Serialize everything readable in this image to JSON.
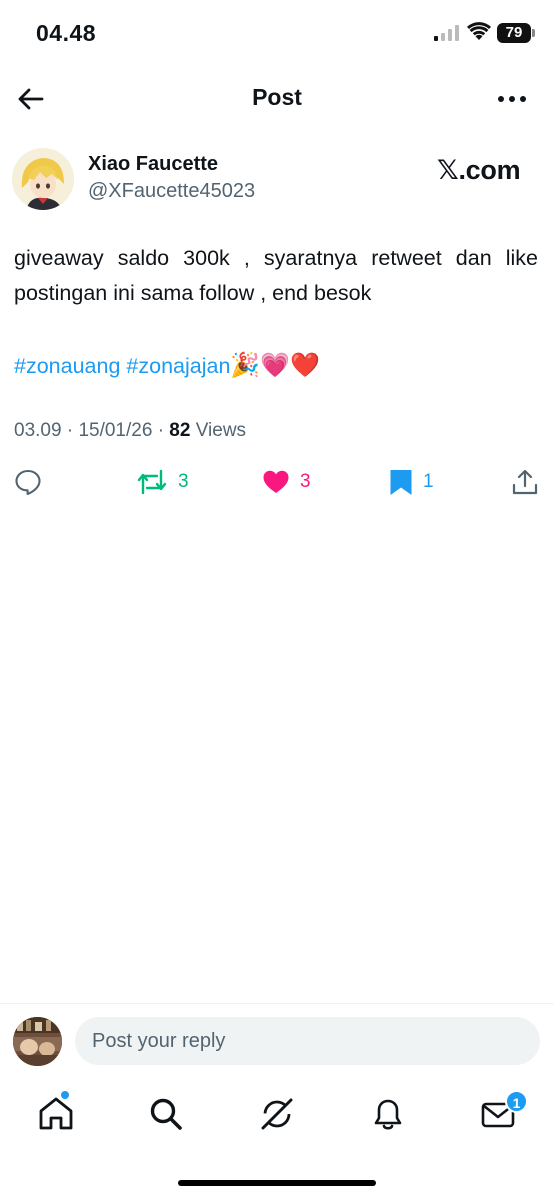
{
  "status_bar": {
    "time": "04.48",
    "battery": "79"
  },
  "header": {
    "title": "Post"
  },
  "author": {
    "name": "Xiao Faucette",
    "handle": "@XFaucette45023",
    "brand": "𝕏.com"
  },
  "post": {
    "text": "giveaway saldo 300k , syaratnya  retweet dan like postingan ini sama follow ,  end besok",
    "hashtags": [
      "#zonauang",
      "#zonajajan"
    ],
    "emojis": "🎉💗❤️",
    "time": "03.09",
    "date": "15/01/26",
    "views_count": "82",
    "views_label": "Views"
  },
  "actions": {
    "retweets": "3",
    "likes": "3",
    "bookmarks": "1"
  },
  "reply": {
    "placeholder": "Post your reply"
  },
  "nav": {
    "messages_badge": "1"
  },
  "colors": {
    "accent": "#1d9bf0",
    "retweet": "#00ba7c",
    "like": "#f91880",
    "text": "#0f1419",
    "secondary": "#536471"
  }
}
